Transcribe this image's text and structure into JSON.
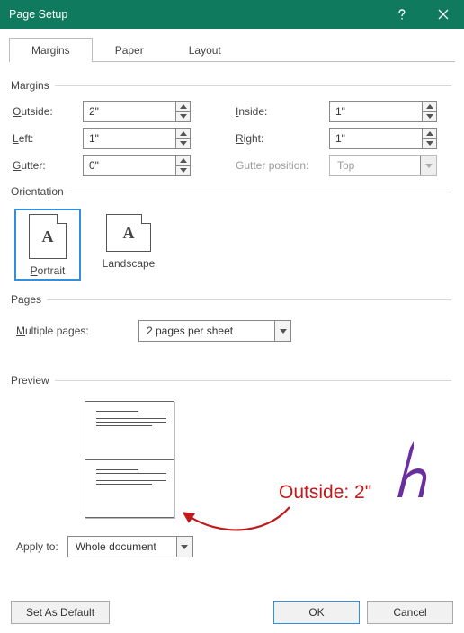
{
  "window": {
    "title": "Page Setup"
  },
  "tabs": {
    "margins": "Margins",
    "paper": "Paper",
    "layout": "Layout"
  },
  "groups": {
    "margins": "Margins",
    "orientation": "Orientation",
    "pages": "Pages",
    "preview": "Preview"
  },
  "margins": {
    "labels": {
      "outside": "utside:",
      "inside": "nside:",
      "left": "eft:",
      "right": "ight:",
      "gutter": "utter:",
      "gutter_pos": "utter position:"
    },
    "values": {
      "outside": "2\"",
      "inside": "1\"",
      "left": "1\"",
      "right": "1\"",
      "gutter": "0\"",
      "gutter_pos": "Top"
    }
  },
  "orientation": {
    "portrait": "ortrait",
    "landscape": "Landscape",
    "glyph": "A"
  },
  "pages": {
    "label": "ultiple pages:",
    "value": "2 pages per sheet"
  },
  "applyto": {
    "label": "pply to:",
    "value": "Whole document"
  },
  "annotation": {
    "text": "Outside: 2\""
  },
  "buttons": {
    "default": "Set As Default",
    "ok": "OK",
    "cancel": "Cancel"
  }
}
